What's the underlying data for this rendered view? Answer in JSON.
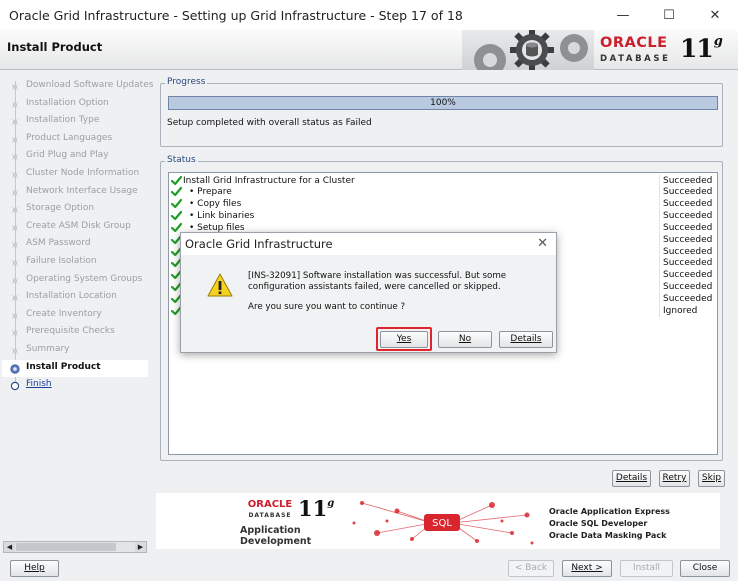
{
  "window": {
    "title": "Oracle Grid Infrastructure - Setting up Grid Infrastructure - Step 17 of 18",
    "minimize": "—",
    "maximize": "☐",
    "close": "✕"
  },
  "header": {
    "step_title": "Install Product",
    "brand_line1": "ORACLE",
    "brand_line2": "DATABASE",
    "version": "11",
    "version_suffix": "g"
  },
  "colors": {
    "brand_red": "#cc1e2b",
    "legend_blue": "#2b4a7d",
    "success_green": "#1f9d2a",
    "highlight_red": "#e0242b"
  },
  "nav": {
    "items": [
      {
        "label": "Download Software Updates",
        "state": "done"
      },
      {
        "label": "Installation Option",
        "state": "done"
      },
      {
        "label": "Installation Type",
        "state": "done"
      },
      {
        "label": "Product Languages",
        "state": "done"
      },
      {
        "label": "Grid Plug and Play",
        "state": "done"
      },
      {
        "label": "Cluster Node Information",
        "state": "done"
      },
      {
        "label": "Network Interface Usage",
        "state": "done"
      },
      {
        "label": "Storage Option",
        "state": "done"
      },
      {
        "label": "Create ASM Disk Group",
        "state": "done"
      },
      {
        "label": "ASM Password",
        "state": "done"
      },
      {
        "label": "Failure Isolation",
        "state": "done"
      },
      {
        "label": "Operating System Groups",
        "state": "done"
      },
      {
        "label": "Installation Location",
        "state": "done"
      },
      {
        "label": "Create Inventory",
        "state": "done"
      },
      {
        "label": "Prerequisite Checks",
        "state": "done"
      },
      {
        "label": "Summary",
        "state": "done"
      },
      {
        "label": "Install Product",
        "state": "current"
      },
      {
        "label": "Finish",
        "state": "next"
      }
    ]
  },
  "progress": {
    "legend": "Progress",
    "percent_label": "100%",
    "fraction": 1.0,
    "message": "Setup completed with overall status as Failed"
  },
  "status": {
    "legend": "Status",
    "rows": [
      {
        "name": "Install Grid Infrastructure for a Cluster",
        "result": "Succeeded",
        "indent": 0
      },
      {
        "name": "• Prepare",
        "result": "Succeeded",
        "indent": 1
      },
      {
        "name": "• Copy files",
        "result": "Succeeded",
        "indent": 1
      },
      {
        "name": "• Link binaries",
        "result": "Succeeded",
        "indent": 1
      },
      {
        "name": "• Setup files",
        "result": "Succeeded",
        "indent": 1
      },
      {
        "name": "",
        "result": "Succeeded",
        "indent": 1
      },
      {
        "name": "",
        "result": "Succeeded",
        "indent": 1
      },
      {
        "name": "",
        "result": "Succeeded",
        "indent": 1
      },
      {
        "name": "",
        "result": "Succeeded",
        "indent": 1
      },
      {
        "name": "",
        "result": "Succeeded",
        "indent": 1
      },
      {
        "name": "",
        "result": "Succeeded",
        "indent": 1
      },
      {
        "name": "",
        "result": "Ignored",
        "indent": 1
      }
    ]
  },
  "status_buttons": {
    "details": "Details",
    "retry": "Retry",
    "skip": "Skip"
  },
  "banner": {
    "brand": "ORACLE",
    "db": "DATABASE",
    "version": "11",
    "version_suffix": "g",
    "line1": "Application",
    "line2": "Development",
    "sql_tag": "SQL",
    "products": [
      "Oracle Application Express",
      "Oracle SQL Developer",
      "Oracle Data Masking Pack"
    ]
  },
  "footer": {
    "help": "Help",
    "back": "< Back",
    "next": "Next >",
    "install": "Install",
    "close": "Close"
  },
  "dialog": {
    "title": "Oracle Grid Infrastructure",
    "message": "[INS-32091] Software installation was successful. But some configuration assistants failed, were cancelled or skipped.",
    "question": "Are you sure you want to continue ?",
    "yes": "Yes",
    "no": "No",
    "details": "Details",
    "icon": "warning-icon"
  }
}
